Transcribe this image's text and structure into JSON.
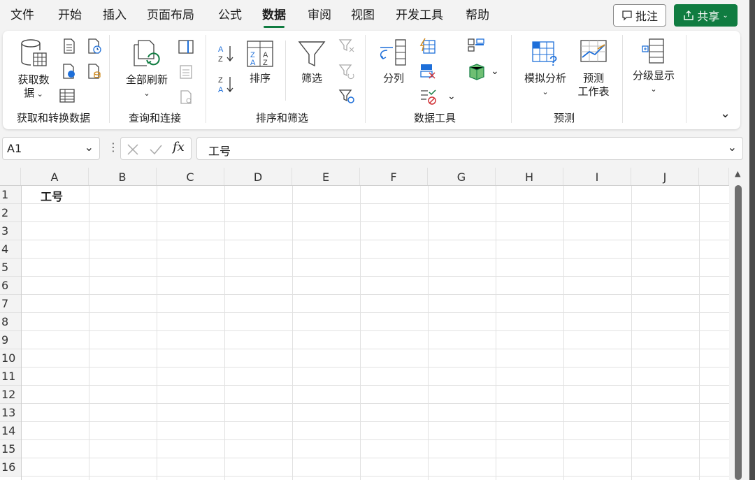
{
  "menu": {
    "items": [
      "文件",
      "开始",
      "插入",
      "页面布局",
      "公式",
      "数据",
      "审阅",
      "视图",
      "开发工具",
      "帮助"
    ],
    "active": "数据",
    "comment_label": "批注",
    "share_label": "共享"
  },
  "ribbon": {
    "groups": {
      "get_transform": "获取和转换数据",
      "queries": "查询和连接",
      "sort_filter": "排序和筛选",
      "data_tools": "数据工具",
      "forecast": "预测"
    },
    "buttons": {
      "get_data_line1": "获取数",
      "get_data_line2": "据",
      "refresh_all": "全部刷新",
      "sort": "排序",
      "filter": "筛选",
      "text_to_columns": "分列",
      "what_if": "模拟分析",
      "forecast_line1": "预测",
      "forecast_line2": "工作表",
      "outline": "分级显示"
    }
  },
  "formula_bar": {
    "name_box": "A1",
    "fx": "fx",
    "content": "工号"
  },
  "sheet": {
    "columns": [
      "A",
      "B",
      "C",
      "D",
      "E",
      "F",
      "G",
      "H",
      "I",
      "J"
    ],
    "rows": [
      "1",
      "2",
      "3",
      "4",
      "5",
      "6",
      "7",
      "8",
      "9",
      "10",
      "11",
      "12",
      "13",
      "14",
      "15",
      "16"
    ],
    "cells": {
      "A1": "工号"
    }
  },
  "colors": {
    "accent": "#107c41"
  }
}
